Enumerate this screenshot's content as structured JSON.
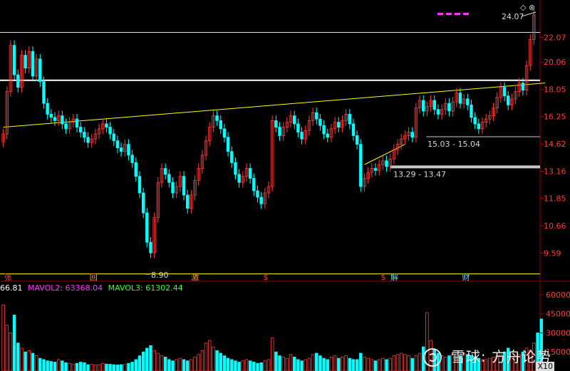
{
  "chart_data": [
    {
      "type": "candlestick",
      "price_axis": {
        "ticks": [
          "22.07",
          "20.06",
          "18.05",
          "16.25",
          "14.62",
          "13.16",
          "11.85",
          "10.66",
          "9.59"
        ],
        "scale": "log",
        "ylim": [
          8.6,
          25.5
        ]
      },
      "price_series": {
        "close": [
          15.2,
          17.9,
          21.4,
          19.1,
          18.2,
          20.6,
          19.6,
          20.9,
          19.0,
          20.3,
          18.6,
          17.1,
          16.4,
          16.2,
          16.0,
          16.3,
          15.8,
          15.5,
          15.9,
          16.1,
          15.6,
          15.3,
          15.0,
          14.7,
          14.9,
          15.2,
          15.5,
          15.8,
          15.6,
          15.2,
          14.8,
          14.4,
          14.2,
          14.6,
          14.0,
          13.6,
          12.9,
          12.1,
          11.2,
          10.0,
          9.6,
          11.0,
          12.6,
          13.3,
          13.0,
          12.6,
          12.1,
          12.4,
          12.9,
          12.0,
          11.4,
          12.0,
          12.7,
          13.3,
          14.0,
          14.8,
          15.6,
          16.3,
          16.0,
          15.5,
          15.0,
          14.2,
          13.6,
          13.0,
          12.6,
          12.9,
          13.3,
          12.8,
          12.2,
          11.9,
          11.6,
          12.1,
          12.4,
          16.0,
          15.6,
          15.1,
          15.6,
          15.9,
          16.3,
          15.8,
          15.3,
          14.9,
          15.4,
          16.0,
          16.5,
          16.1,
          15.7,
          15.2,
          15.0,
          15.5,
          15.9,
          15.6,
          16.0,
          16.4,
          15.8,
          15.1,
          14.6,
          12.4,
          12.8,
          13.1,
          13.3,
          13.2,
          13.5,
          13.7,
          13.4,
          13.8,
          14.3,
          14.6,
          14.9,
          15.1,
          15.3,
          15.0,
          16.8,
          17.3,
          16.6,
          16.9,
          17.3,
          16.7,
          16.4,
          16.7,
          17.1,
          16.6,
          17.2,
          17.8,
          17.1,
          17.4,
          17.0,
          16.2,
          15.8,
          15.5,
          15.9,
          16.1,
          16.3,
          16.8,
          17.5,
          18.2,
          17.6,
          17.0,
          17.4,
          17.9,
          18.5,
          18.0,
          19.8,
          21.9,
          24.07
        ],
        "high_marker": 24.07,
        "low_marker": 8.9
      },
      "annotations": {
        "high_label": "24.07",
        "low_label": "8.90",
        "range_a_label": "15.03 - 15.04",
        "range_b_label": "13.29 - 13.47"
      },
      "reference_lines": {
        "horizontal_levels": [
          22.5,
          18.7,
          15.035,
          13.38,
          8.85
        ],
        "trendline_a": [
          [
            0,
            15.6
          ],
          [
            147,
            18.5
          ]
        ],
        "trendline_b": [
          [
            98,
            13.5
          ],
          [
            109,
            14.6
          ]
        ]
      },
      "event_markers": [
        "张",
        "回",
        "激",
        "$",
        "$",
        "解",
        "财"
      ],
      "colors": {
        "up": "#ff3b3b",
        "down": "#00ffff",
        "background": "#000000",
        "axis_text": "#ff3b3b",
        "trendline": "#ffff00",
        "level": "#ffffff"
      }
    },
    {
      "type": "volume-bar",
      "axis_ticks": [
        "60000",
        "45000",
        "30000",
        "15000"
      ],
      "ylim": [
        0,
        65000
      ],
      "values": [
        52000,
        36000,
        30000,
        44000,
        22000,
        18000,
        15000,
        16000,
        14000,
        12000,
        10000,
        9000,
        8000,
        7500,
        7000,
        9000,
        8000,
        6500,
        6000,
        5500,
        6000,
        7000,
        6500,
        5000,
        5200,
        4800,
        5000,
        6000,
        5500,
        5300,
        5000,
        4800,
        5000,
        5200,
        6000,
        7000,
        9000,
        12000,
        15000,
        18000,
        20000,
        16000,
        14000,
        12000,
        11000,
        9000,
        8000,
        9000,
        10000,
        9000,
        8000,
        9000,
        11000,
        13000,
        16000,
        22000,
        24000,
        19000,
        16000,
        14000,
        12000,
        10000,
        9000,
        8000,
        7000,
        8000,
        9000,
        8000,
        7000,
        6000,
        6500,
        8000,
        9000,
        26000,
        15000,
        12000,
        11000,
        10000,
        13000,
        11000,
        9000,
        8000,
        9000,
        10000,
        13000,
        14000,
        12000,
        10000,
        9000,
        11000,
        12000,
        10000,
        11000,
        12000,
        10000,
        9000,
        9000,
        14000,
        11000,
        10000,
        9000,
        8000,
        9000,
        10000,
        9000,
        10000,
        12000,
        13000,
        14000,
        13000,
        12000,
        10000,
        12000,
        14000,
        19000,
        46000,
        24000,
        17000,
        14000,
        12000,
        11000,
        12000,
        13000,
        11000,
        12000,
        14000,
        13000,
        12000,
        11000,
        10000,
        9000,
        9000,
        10000,
        11000,
        12000,
        13000,
        15000,
        18000,
        14000,
        12000,
        13000,
        15000,
        18000,
        16000,
        22000,
        30000,
        41000
      ]
    }
  ],
  "volume_legend": {
    "mavol1": "66.81",
    "mavol2": "MAVOL2: 63368.04",
    "mavol3": "MAVOL3: 61302.44"
  },
  "watermark": "雪球: 方舟论势",
  "zoom_badge": "X10",
  "corner_icons": [
    "◇",
    "⊗"
  ]
}
